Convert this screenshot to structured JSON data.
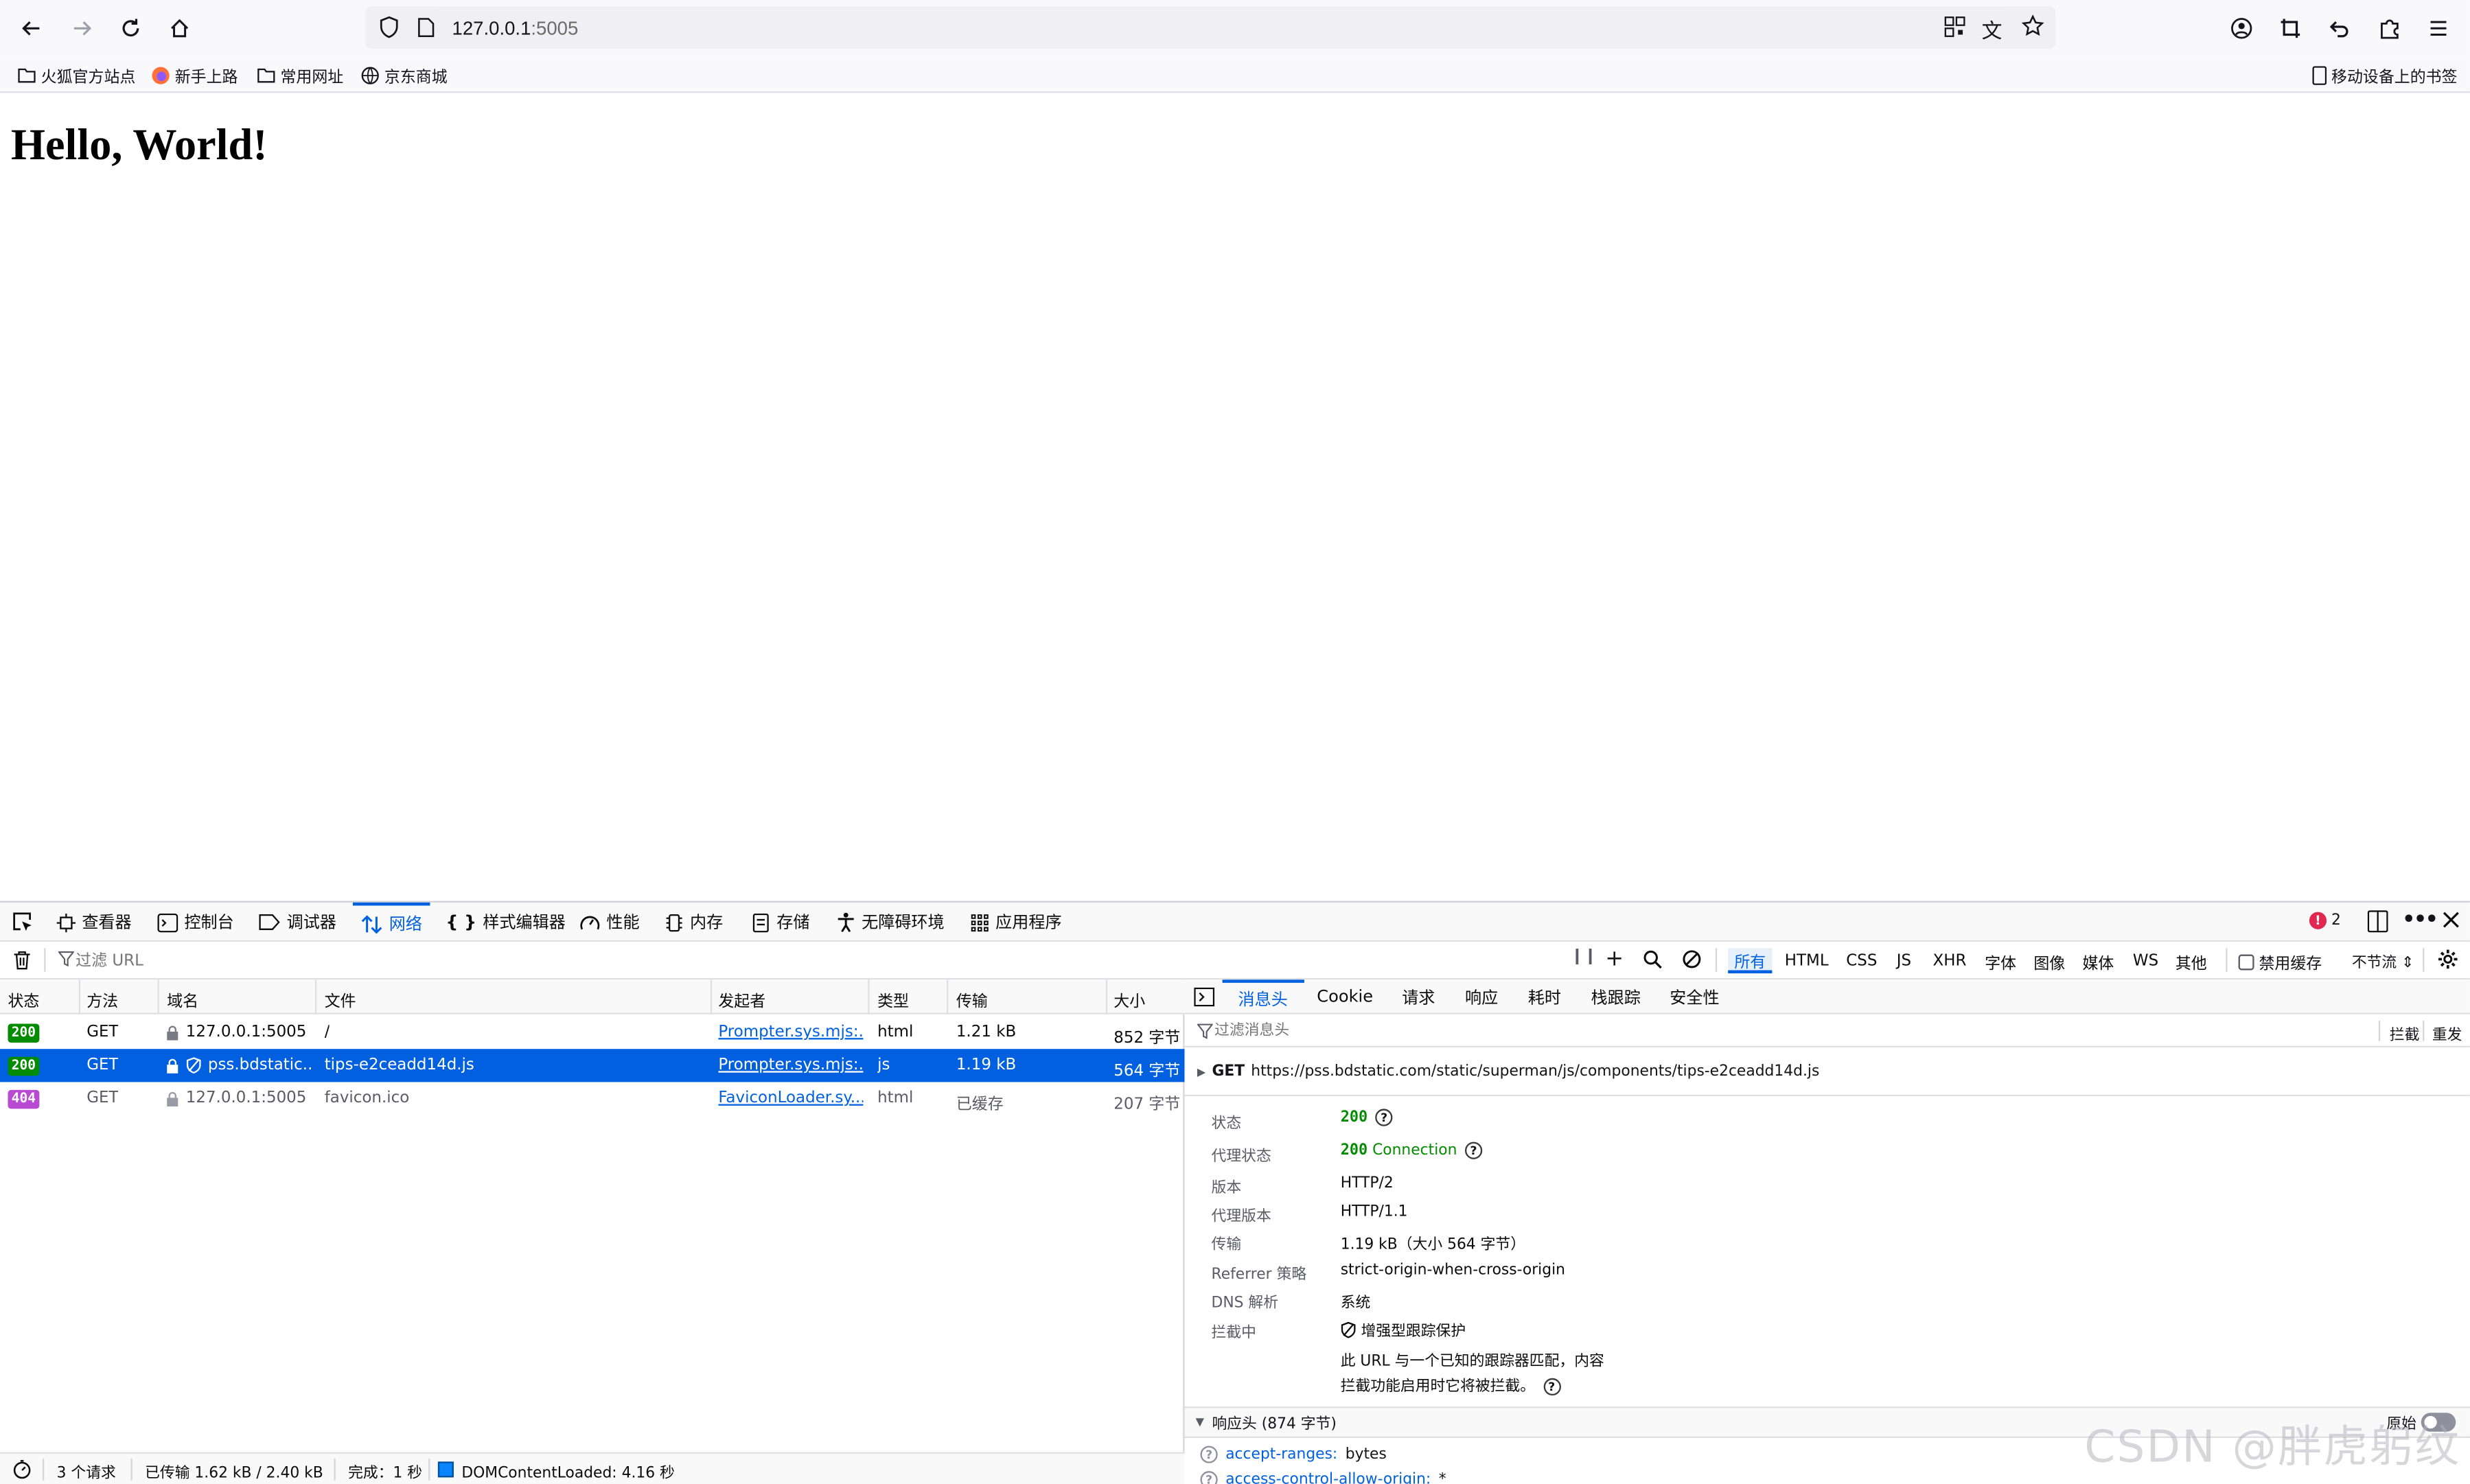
{
  "browser": {
    "url_host": "127.0.0.1",
    "url_port": ":5005",
    "bookmarks": [
      "火狐官方站点",
      "新手上路",
      "常用网址",
      "京东商城"
    ],
    "mobile_bookmarks": "移动设备上的书签"
  },
  "page": {
    "heading": "Hello, World!"
  },
  "devtools": {
    "tabs": [
      "查看器",
      "控制台",
      "调试器",
      "网络",
      "样式编辑器",
      "性能",
      "内存",
      "存储",
      "无障碍环境",
      "应用程序"
    ],
    "error_count": "2",
    "filter_placeholder": "过滤 URL",
    "filter_types": [
      "所有",
      "HTML",
      "CSS",
      "JS",
      "XHR",
      "字体",
      "图像",
      "媒体",
      "WS",
      "其他"
    ],
    "disable_cache": "禁用缓存",
    "throttle": "不节流 ⇕",
    "columns": [
      "状态",
      "方法",
      "域名",
      "文件",
      "发起者",
      "类型",
      "传输",
      "大小"
    ],
    "requests": [
      {
        "status": "200",
        "method": "GET",
        "domain": "127.0.0.1:5005",
        "file": "/",
        "initiator": "Prompter.sys.mjs:...",
        "type": "html",
        "transfer": "1.21 kB",
        "size": "852 字节"
      },
      {
        "status": "200",
        "method": "GET",
        "domain": "pss.bdstatic...",
        "file": "tips-e2ceadd14d.js",
        "initiator": "Prompter.sys.mjs:...",
        "type": "js",
        "transfer": "1.19 kB",
        "size": "564 字节"
      },
      {
        "status": "404",
        "method": "GET",
        "domain": "127.0.0.1:5005",
        "file": "favicon.ico",
        "initiator": "FaviconLoader.sy...",
        "type": "html",
        "transfer": "已缓存",
        "size": "207 字节"
      }
    ],
    "statusbar": {
      "count": "3 个请求",
      "transferred": "已传输 1.62 kB / 2.40 kB",
      "finish": "完成：1 秒",
      "dcl": "DOMContentLoaded: 4.16 秒"
    },
    "detail": {
      "tabs": [
        "消息头",
        "Cookie",
        "请求",
        "响应",
        "耗时",
        "栈跟踪",
        "安全性"
      ],
      "filter_placeholder": "过滤消息头",
      "block": "拦截",
      "resend": "重发",
      "request_method": "GET",
      "request_url": "https://pss.bdstatic.com/static/superman/js/components/tips-e2ceadd14d.js",
      "fields": {
        "status_label": "状态",
        "status_value": "200",
        "proxy_status_label": "代理状态",
        "proxy_status_code": "200",
        "proxy_status_text": "Connection",
        "version_label": "版本",
        "version_value": "HTTP/2",
        "proxy_version_label": "代理版本",
        "proxy_version_value": "HTTP/1.1",
        "transfer_label": "传输",
        "transfer_value": "1.19 kB（大小 564 字节）",
        "referrer_label": "Referrer 策略",
        "referrer_value": "strict-origin-when-cross-origin",
        "dns_label": "DNS 解析",
        "dns_value": "系统",
        "blocked_label": "拦截中",
        "blocked_value": "增强型跟踪保护",
        "blocked_note1": "此 URL 与一个已知的跟踪器匹配，内容",
        "blocked_note2": "拦截功能启用时它将被拦截。"
      },
      "response_headers_title": "响应头 (874 字节)",
      "raw": "原始",
      "headers": [
        {
          "name": "accept-ranges:",
          "value": "bytes"
        },
        {
          "name": "access-control-allow-origin:",
          "value": "*"
        }
      ]
    }
  },
  "watermark": "CSDN @胖虎躬纹"
}
